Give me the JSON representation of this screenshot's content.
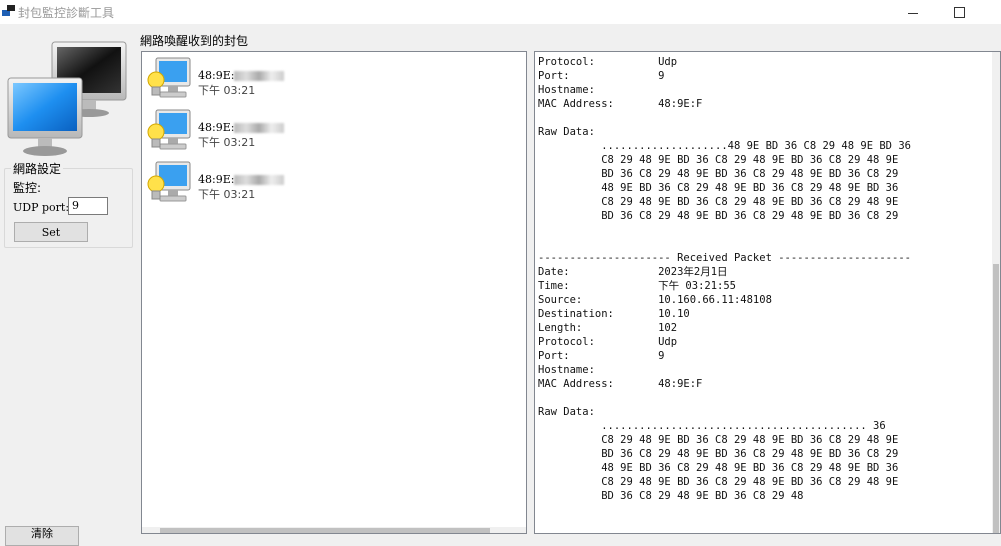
{
  "window": {
    "title": "封包監控診斷工具",
    "icon": "network-app-icon"
  },
  "settings": {
    "group_label": "網路設定",
    "monitor_label": "監控:",
    "udp_port_label": "UDP port:",
    "udp_port_value": "9",
    "set_label": "Set",
    "clear_label": "清除"
  },
  "packet_list": {
    "title": "網路喚醒收到的封包",
    "items": [
      {
        "mac": "48:9E:",
        "time": "下午 03:21",
        "icon": "computer-bulb-icon"
      },
      {
        "mac": "48:9E:",
        "time": "下午 03:21",
        "icon": "computer-bulb-icon"
      },
      {
        "mac": "48:9E:",
        "time": "下午 03:21",
        "icon": "computer-bulb-icon"
      }
    ]
  },
  "detail": {
    "text": "Protocol:          Udp\nPort:              9\nHostname:\nMAC Address:       48:9E:F\n\nRaw Data:\n          ....................48 9E BD 36 C8 29 48 9E BD 36\n          C8 29 48 9E BD 36 C8 29 48 9E BD 36 C8 29 48 9E\n          BD 36 C8 29 48 9E BD 36 C8 29 48 9E BD 36 C8 29\n          48 9E BD 36 C8 29 48 9E BD 36 C8 29 48 9E BD 36\n          C8 29 48 9E BD 36 C8 29 48 9E BD 36 C8 29 48 9E\n          BD 36 C8 29 48 9E BD 36 C8 29 48 9E BD 36 C8 29\n\n\n--------------------- Received Packet ---------------------\nDate:              2023年2月1日\nTime:              下午 03:21:55\nSource:            10.160.66.11:48108\nDestination:       10.10\nLength:            102\nProtocol:          Udp\nPort:              9\nHostname:\nMAC Address:       48:9E:F\n\nRaw Data:\n          .......................................... 36\n          C8 29 48 9E BD 36 C8 29 48 9E BD 36 C8 29 48 9E\n          BD 36 C8 29 48 9E BD 36 C8 29 48 9E BD 36 C8 29\n          48 9E BD 36 C8 29 48 9E BD 36 C8 29 48 9E BD 36\n          C8 29 48 9E BD 36 C8 29 48 9E BD 36 C8 29 48 9E\n          BD 36 C8 29 48 9E BD 36 C8 29 48"
  }
}
